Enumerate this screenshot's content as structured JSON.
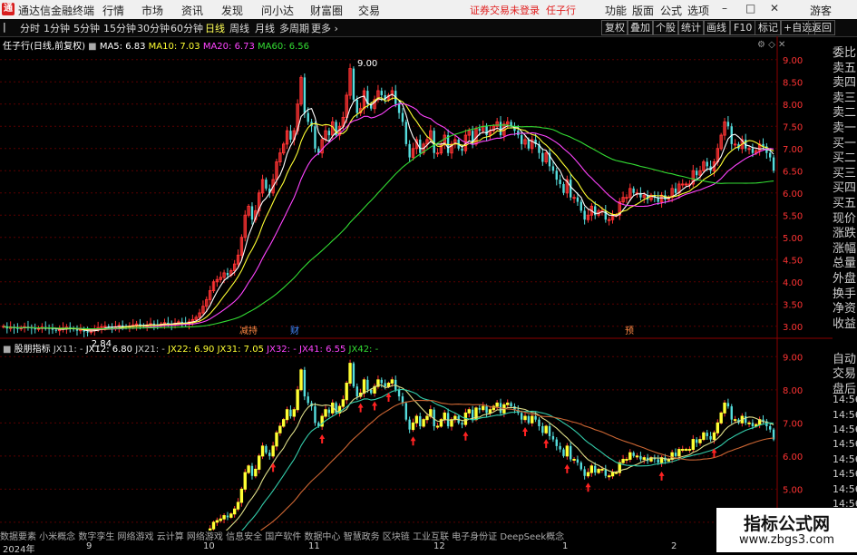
{
  "titlebar": {
    "app_name": "通达信金融终端",
    "menus": [
      "行情",
      "市场",
      "资讯",
      "发现",
      "问小达",
      "财富圈",
      "交易"
    ],
    "login_status": "证券交易未登录",
    "stock_name": "任子行",
    "right_menus": [
      "功能",
      "版面",
      "公式",
      "选项"
    ],
    "guest": "游客",
    "logo_char": "通"
  },
  "toolbar": {
    "periods": [
      "分时",
      "1分钟",
      "5分钟",
      "15分钟",
      "30分钟",
      "60分钟",
      "日线",
      "周线",
      "月线",
      "多周期",
      "更多"
    ],
    "active_period": "日线",
    "right_buttons": [
      "复权",
      "叠加",
      "个股",
      "统计",
      "画线",
      "F10",
      "标记",
      "+自选",
      "返回"
    ]
  },
  "main_chart": {
    "title": "任子行(日线,前复权)",
    "ma_legend": [
      {
        "label": "MA5: 6.83",
        "color": "#ffffff"
      },
      {
        "label": "MA10: 7.03",
        "color": "#ffff33"
      },
      {
        "label": "MA20: 6.73",
        "color": "#ff44ff"
      },
      {
        "label": "MA60: 6.56",
        "color": "#33dd33"
      }
    ],
    "high_marker": "9.00",
    "low_marker": "2.84",
    "event_tags": [
      "减持",
      "财",
      "预"
    ]
  },
  "indicator": {
    "title": "股朋指标",
    "legend": [
      {
        "label": "JX11: -",
        "color": "#cccccc"
      },
      {
        "label": "JX12: 6.80",
        "color": "#ffffff"
      },
      {
        "label": "JX21: -",
        "color": "#cccccc"
      },
      {
        "label": "JX22: 6.90",
        "color": "#ffff33"
      },
      {
        "label": "JX31: 7.05",
        "color": "#ffff33"
      },
      {
        "label": "JX32: -",
        "color": "#ff44ff"
      },
      {
        "label": "JX41: 6.55",
        "color": "#ff44ff"
      },
      {
        "label": "JX42: -",
        "color": "#33dd33"
      }
    ]
  },
  "right_panel": {
    "top_items": [
      "委比",
      "卖五",
      "卖四",
      "卖三",
      "卖二",
      "卖一",
      "买一",
      "买二",
      "买三",
      "买四",
      "买五",
      "现价",
      "涨跌",
      "涨幅",
      "总量",
      "外盘",
      "换手",
      "净资",
      "收益"
    ],
    "bottom_items": [
      "自动",
      "交易",
      "盘后",
      "14:56",
      "14:56",
      "14:56",
      "14:56",
      "14:56",
      "14:56",
      "14:56",
      "14:56",
      "14:56"
    ]
  },
  "footer": {
    "concepts": "数据要素 小米概念 数字孪生 网络游戏 云计算 网络游戏 信息安全 国产软件 数据中心 智慧政务 区块链 工业互联 电子身份证 DeepSeek概念"
  },
  "dates": [
    "2024年",
    "9",
    "10",
    "11",
    "12",
    "1",
    "2"
  ],
  "watermark": {
    "line1": "指标公式网",
    "line2": "www.zbgs3.com"
  },
  "chart_data": [
    {
      "type": "candlestick",
      "title": "任子行(日线,前复权)",
      "y_ticks": [
        9.0,
        8.5,
        8.0,
        7.5,
        7.0,
        6.5,
        6.0,
        5.5,
        5.0,
        4.5,
        4.0,
        3.5,
        3.0
      ],
      "ylim": [
        2.75,
        9.2
      ],
      "close": [
        3.0,
        2.95,
        2.98,
        2.96,
        2.94,
        2.97,
        2.99,
        2.97,
        2.95,
        2.93,
        2.96,
        2.98,
        2.97,
        2.95,
        2.92,
        2.9,
        2.93,
        2.96,
        2.98,
        2.95,
        2.93,
        2.9,
        2.92,
        2.88,
        2.86,
        2.9,
        2.94,
        2.97,
        2.99,
        3.0,
        2.98,
        2.96,
        2.99,
        3.02,
        3.0,
        2.98,
        3.0,
        3.03,
        3.05,
        3.02,
        3.0,
        3.03,
        3.06,
        3.04,
        3.02,
        3.05,
        3.08,
        3.06,
        3.04,
        3.07,
        3.1,
        3.08,
        3.06,
        3.1,
        3.15,
        3.2,
        3.3,
        3.45,
        3.6,
        3.8,
        4.0,
        4.05,
        4.1,
        4.2,
        4.15,
        4.25,
        4.4,
        4.6,
        5.0,
        5.5,
        5.7,
        5.4,
        5.6,
        6.0,
        6.3,
        6.1,
        6.0,
        6.3,
        6.7,
        6.9,
        7.1,
        7.4,
        7.2,
        7.4,
        8.0,
        8.6,
        7.8,
        7.6,
        7.5,
        7.0,
        6.9,
        7.2,
        7.4,
        7.3,
        7.6,
        7.3,
        7.5,
        7.7,
        8.2,
        8.8,
        8.1,
        7.8,
        7.9,
        8.3,
        8.0,
        7.9,
        8.1,
        8.3,
        8.2,
        8.1,
        8.2,
        8.3,
        8.0,
        7.8,
        7.6,
        7.1,
        6.8,
        7.0,
        7.2,
        6.9,
        7.1,
        7.2,
        7.4,
        6.9,
        6.9,
        7.1,
        7.3,
        6.9,
        7.1,
        7.2,
        7.0,
        6.95,
        7.3,
        7.4,
        7.1,
        7.45,
        7.4,
        7.5,
        7.3,
        7.4,
        7.5,
        7.6,
        7.3,
        7.55,
        7.6,
        7.5,
        7.4,
        7.3,
        7.1,
        7.2,
        7.0,
        7.2,
        7.1,
        6.9,
        6.7,
        6.9,
        6.6,
        6.5,
        6.3,
        6.2,
        6.0,
        6.3,
        5.9,
        5.9,
        5.8,
        5.6,
        5.4,
        5.5,
        5.7,
        5.5,
        5.6,
        5.6,
        5.4,
        5.4,
        5.5,
        5.5,
        5.8,
        5.9,
        5.9,
        6.1,
        6.0,
        6.0,
        5.9,
        5.95,
        5.85,
        5.95,
        5.9,
        5.8,
        5.95,
        5.85,
        5.9,
        6.1,
        6.0,
        6.2,
        6.2,
        6.2,
        6.2,
        6.5,
        6.4,
        6.5,
        6.7,
        6.6,
        6.5,
        6.7,
        7.0,
        7.3,
        7.6,
        7.5,
        7.1,
        7.1,
        7.0,
        7.2,
        7.0,
        7.0,
        6.9,
        6.95,
        7.1,
        7.05,
        6.9,
        6.8,
        6.5
      ],
      "ma_current": {
        "MA5": 6.83,
        "MA10": 7.03,
        "MA20": 6.73,
        "MA60": 6.56
      }
    },
    {
      "type": "bar",
      "title": "股朋指标",
      "y_ticks": [
        9.0,
        8.0,
        7.0,
        6.0,
        5.0,
        4.0
      ],
      "ylim": [
        3.75,
        9.2
      ],
      "legend": {
        "JX12": 6.8,
        "JX22": 6.9,
        "JX31": 7.05,
        "JX41": 6.55
      }
    }
  ],
  "colors": {
    "up": "#ff3333",
    "down": "#55dddd",
    "axis_text": "#ff3333",
    "grid": "#5a0000"
  }
}
